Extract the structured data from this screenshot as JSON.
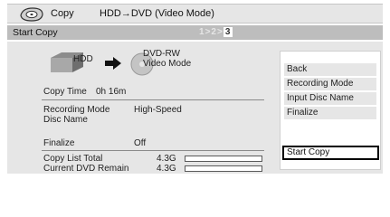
{
  "header": {
    "title": "Copy",
    "mode": "HDD→DVD (Video Mode)"
  },
  "stepbar": {
    "title": "Start Copy",
    "steps": [
      "1",
      "2",
      "3"
    ],
    "current_step": 3
  },
  "transfer": {
    "source": "HDD",
    "target_line1": "DVD-RW",
    "target_line2": "Video Mode"
  },
  "info": {
    "copy_time_label": "Copy Time",
    "copy_time_value": "0h 16m",
    "recording_mode_label": "Recording Mode",
    "recording_mode_value": "High-Speed",
    "disc_name_label": "Disc Name",
    "finalize_label": "Finalize",
    "finalize_value": "Off",
    "copy_list_total_label": "Copy List Total",
    "copy_list_total_value": "4.3G",
    "current_dvd_remain_label": "Current DVD Remain",
    "current_dvd_remain_value": "4.3G"
  },
  "menu": {
    "items": [
      "Back",
      "Recording Mode",
      "Input Disc Name",
      "Finalize"
    ],
    "start_copy": "Start Copy"
  },
  "colors": {
    "panel_bg": "#e6e6e6",
    "bar_bg": "#bdbdbd",
    "highlight_border": "#000000"
  },
  "icons": {
    "logo": "dvd-disc-icon",
    "source": "hdd-icon",
    "arrow": "arrow-right-icon",
    "target": "dvd-disc-icon"
  }
}
